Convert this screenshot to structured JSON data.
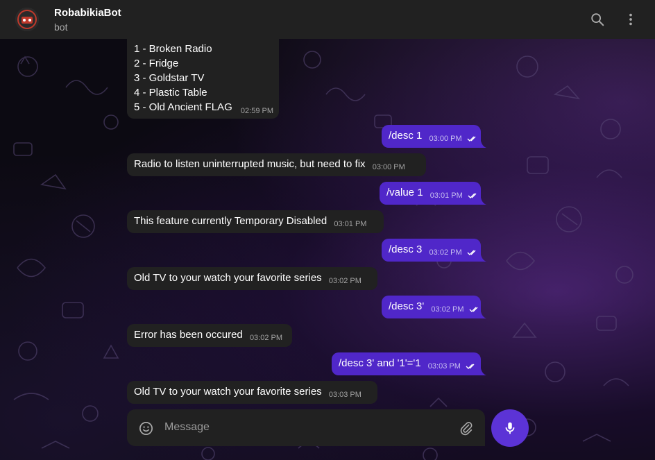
{
  "header": {
    "title": "RobabikiaBot",
    "subtitle": "bot",
    "search_icon": "search-icon",
    "menu_icon": "more-vertical-icon"
  },
  "menu_message": {
    "lines": [
      "1 - Broken Radio",
      "2 - Fridge",
      "3 - Goldstar TV",
      "4 - Plastic Table",
      "5 - Old Ancient FLAG"
    ],
    "time": "02:59 PM"
  },
  "messages": [
    {
      "direction": "out",
      "text": "/desc 1",
      "time": "03:00 PM",
      "status": "read"
    },
    {
      "direction": "in",
      "text": "Radio to listen uninterrupted music, but need to fix",
      "time": "03:00 PM"
    },
    {
      "direction": "out",
      "text": "/value 1",
      "time": "03:01 PM",
      "status": "read"
    },
    {
      "direction": "in",
      "text": "This feature currently Temporary Disabled",
      "time": "03:01 PM"
    },
    {
      "direction": "out",
      "text": "/desc 3",
      "time": "03:02 PM",
      "status": "read"
    },
    {
      "direction": "in",
      "text": "Old TV to your watch your favorite series",
      "time": "03:02 PM"
    },
    {
      "direction": "out",
      "text": "/desc 3'",
      "time": "03:02 PM",
      "status": "read"
    },
    {
      "direction": "in",
      "text": "Error has been occured",
      "time": "03:02 PM"
    },
    {
      "direction": "out",
      "text": "/desc 3' and '1'='1",
      "time": "03:03 PM",
      "status": "read"
    },
    {
      "direction": "in",
      "text": "Old TV to your watch your favorite series",
      "time": "03:03 PM"
    }
  ],
  "composer": {
    "placeholder": "Message",
    "emoji_icon": "emoji-icon",
    "attach_icon": "paperclip-icon",
    "mic_icon": "microphone-icon"
  },
  "colors": {
    "header_bg": "#212121",
    "incoming_bubble": "#212121",
    "outgoing_bubble": "#5027c9",
    "accent": "#5c33d6"
  }
}
